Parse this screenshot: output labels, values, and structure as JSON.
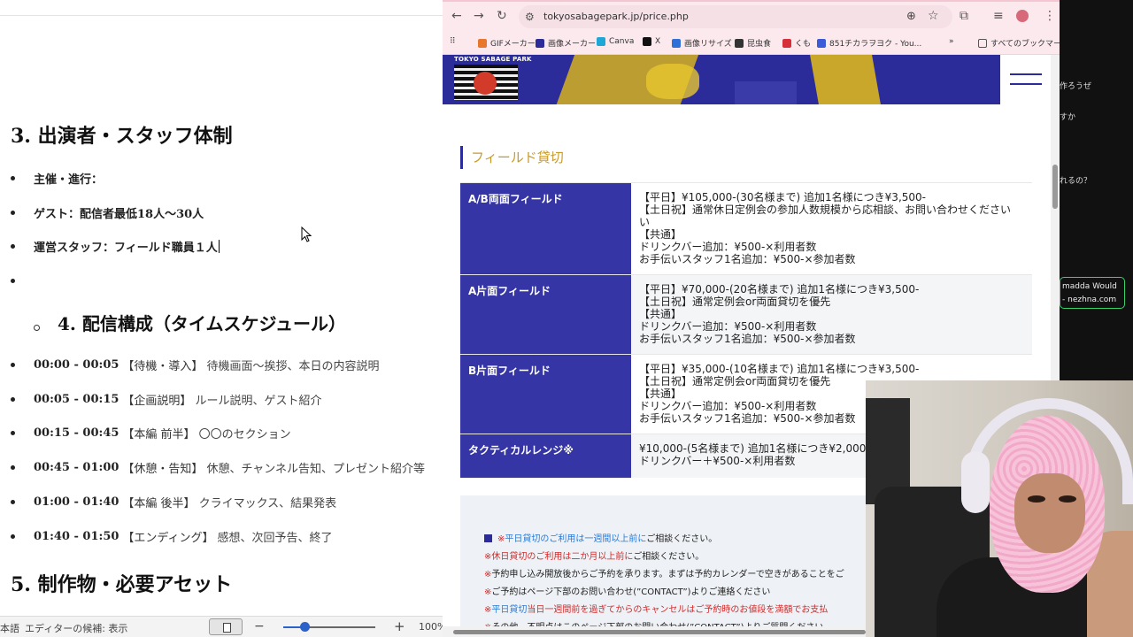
{
  "document": {
    "heading3": "3. 出演者・スタッフ体制",
    "staff_bullets": [
      {
        "label": "主催・進行："
      },
      {
        "label": "ゲスト：配信者最低18人〜30人"
      },
      {
        "label": "運営スタッフ：フィールド職員１人"
      }
    ],
    "heading4": "4. 配信構成（タイムスケジュール）",
    "schedule": [
      {
        "time": "00:00 - 00:05",
        "tag": "【待機・導入】",
        "desc": "待機画面〜挨拶、本日の内容説明"
      },
      {
        "time": "00:05 - 00:15",
        "tag": "【企画説明】",
        "desc": "ルール説明、ゲスト紹介"
      },
      {
        "time": "00:15 - 00:45",
        "tag": "【本編 前半】",
        "desc": "〇〇のセクション"
      },
      {
        "time": "00:45 - 01:00",
        "tag": "【休憩・告知】",
        "desc": "休憩、チャンネル告知、プレゼント紹介等"
      },
      {
        "time": "01:00 - 01:40",
        "tag": "【本編 後半】",
        "desc": "クライマックス、結果発表"
      },
      {
        "time": "01:40 - 01:50",
        "tag": "【エンディング】",
        "desc": "感想、次回予告、終了"
      }
    ],
    "heading5": "5. 制作物・必要アセット",
    "statusbar": {
      "language": "本語",
      "suggestions": "エディターの候補: 表示",
      "zoom_minus": "−",
      "zoom_plus": "+",
      "zoom_level": "100%"
    }
  },
  "browser": {
    "url": "tokyosabagepark.jp/price.php",
    "bookmarks": [
      {
        "label": "GIFメーカー",
        "color": "#e8762c"
      },
      {
        "label": "画像メーカー",
        "color": "#2b2c9a"
      },
      {
        "label": "Canva",
        "color": "#1fa7d6"
      },
      {
        "label": "X",
        "color": "#111111"
      },
      {
        "label": "画像リサイズ",
        "color": "#2f6fd8"
      },
      {
        "label": "昆虫食",
        "color": "#333333"
      },
      {
        "label": "くも",
        "color": "#d62f3a"
      },
      {
        "label": "851チカラヲヨク - You...",
        "color": "#3a5ad8"
      }
    ],
    "bookmarks_more": "»",
    "all_bookmarks": "すべてのブックマーク",
    "site": {
      "logo_text": "TOKYO SABAGE PARK",
      "section_title": "フィールド貸切",
      "prices": [
        {
          "name": "A/B両面フィールド",
          "detail": "【平日】¥105,000-(30名様まで) 追加1名様につき¥3,500-\n【土日祝】通常休日定例会の参加人数規模から応相談、お問い合わせください\nい\n【共通】\nドリンクバー追加：¥500-×利用者数\nお手伝いスタッフ1名追加：¥500-×参加者数"
        },
        {
          "name": "A片面フィールド",
          "detail": "【平日】¥70,000-(20名様まで) 追加1名様につき¥3,500-\n【土日祝】通常定例会or両面貸切を優先\n【共通】\nドリンクバー追加：¥500-×利用者数\nお手伝いスタッフ1名追加：¥500-×参加者数"
        },
        {
          "name": "B片面フィールド",
          "detail": "【平日】¥35,000-(10名様まで) 追加1名様につき¥3,500-\n【土日祝】通常定例会or両面貸切を優先\n【共通】\nドリンクバー追加：¥500-×利用者数\nお手伝いスタッフ1名追加：¥500-×参加者数"
        },
        {
          "name": "タクティカルレンジ※",
          "detail": "¥10,000-(5名様まで) 追加1名様につき¥2,000\nドリンクバー＋¥500-×利用者数"
        }
      ],
      "notes": [
        {
          "prefix": "※",
          "highlight": "平日貸切のご利用は一週間以上前に",
          "rest": "ご相談ください。",
          "style": "blue"
        },
        {
          "prefix": "※",
          "highlight": "休日貸切のご利用は二か月以上前に",
          "rest": "ご相談ください。",
          "style": "red"
        },
        {
          "prefix": "※",
          "highlight": "",
          "rest": "予約申し込み開放後からご予約を承ります。まずは予約カレンダーで空きがあることをご",
          "style": ""
        },
        {
          "prefix": "※",
          "highlight": "",
          "rest": "ご予約はページ下部のお問い合わせ(”CONTACT”)よりご連絡ください",
          "style": ""
        },
        {
          "prefix": "※",
          "highlight": "平日貸切",
          "rest": "当日一週間前を過ぎてからのキャンセルはご予約時のお値段を満額でお支払",
          "style": "blue"
        },
        {
          "prefix": "※",
          "highlight": "",
          "rest": "その他、不明点はこのページ下部のお問い合わせ(”CONTACT”)よりご質問ください",
          "style": ""
        }
      ]
    }
  },
  "chat": {
    "lines": [
      "作ろうぜ",
      "すか",
      "れるの？"
    ],
    "box_line1": "madda Would",
    "box_line2": "- nezhna.com"
  }
}
